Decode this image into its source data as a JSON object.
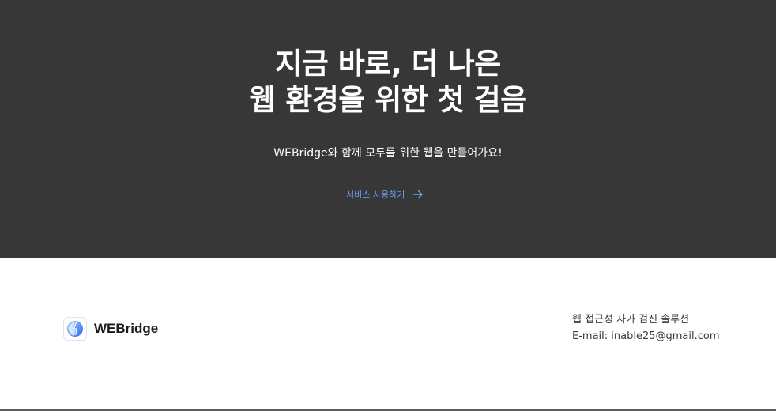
{
  "hero": {
    "title_line1": "지금 바로, 더 나은",
    "title_line2": "웹 환경을 위한 첫 걸음",
    "subtitle": "WEBridge와 함께 모두를 위한 웹을 만들어가요!",
    "cta_label": "서비스 사용하기",
    "cta_icon": "arrow-right-icon",
    "colors": {
      "background": "#373737",
      "cta": "#6f9ff5"
    }
  },
  "footer": {
    "logo_icon": "webridge-logo-icon",
    "brand": "WEBridge",
    "tagline": "웹 접근성 자가 검진 솔루션",
    "email": "E-mail: inable25@gmail.com"
  }
}
